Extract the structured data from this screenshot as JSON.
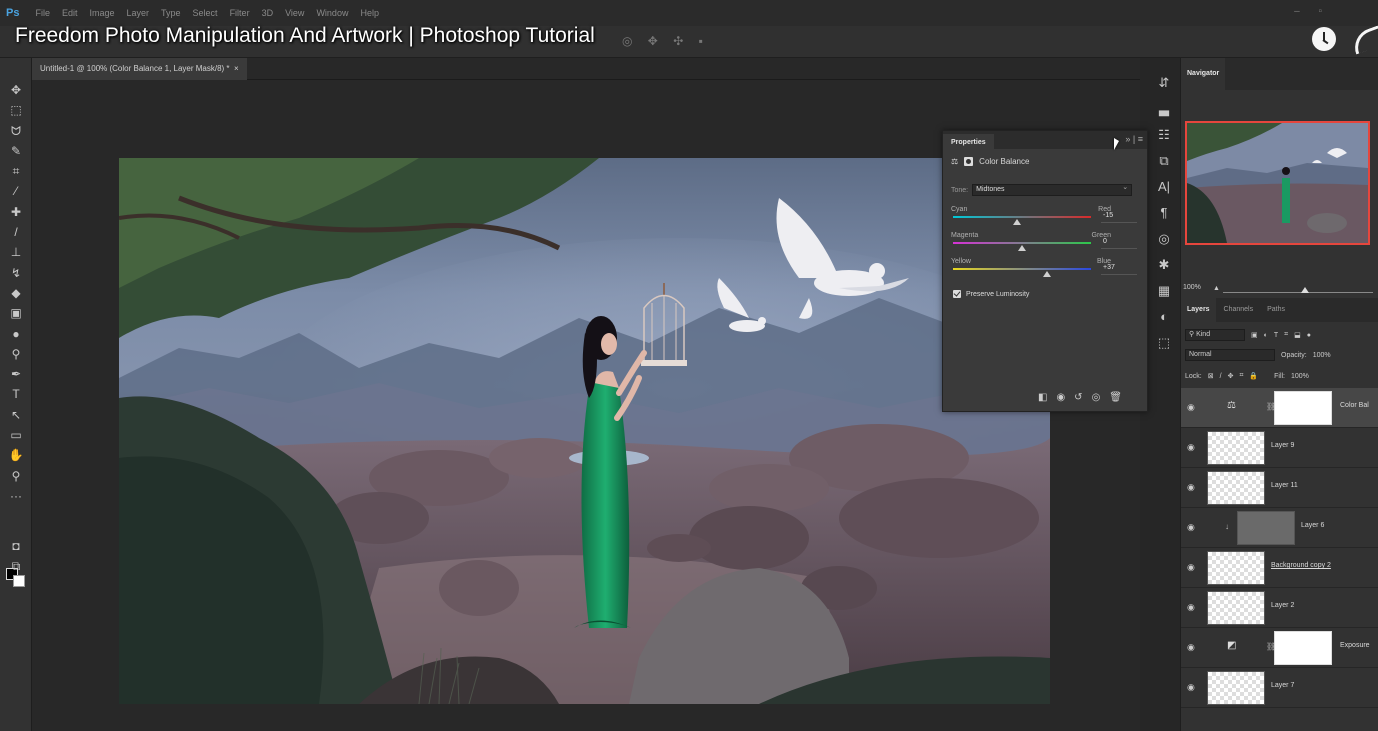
{
  "video_title": "Freedom Photo Manipulation And Artwork | Photoshop Tutorial",
  "app": {
    "logo": "Ps",
    "menu": [
      "File",
      "Edit",
      "Image",
      "Layer",
      "Type",
      "Select",
      "Filter",
      "3D",
      "View",
      "Window",
      "Help"
    ]
  },
  "document": {
    "tab_label": "Untitled-1 @ 100% (Color Balance 1, Layer Mask/8) *",
    "close_glyph": "×"
  },
  "properties": {
    "tab": "Properties",
    "collapse_glyph": "»",
    "menu_glyph": "≡",
    "adjustment_name": "Color Balance",
    "tone_label": "Tone:",
    "tone_value": "Midtones",
    "sliders": [
      {
        "left": "Cyan",
        "right": "Red",
        "value": "-15",
        "colors": [
          "#00c8d8",
          "#d82a2a"
        ],
        "position": 0.43
      },
      {
        "left": "Magenta",
        "right": "Green",
        "value": "0",
        "colors": [
          "#d632d6",
          "#2cc84a"
        ],
        "position": 0.5
      },
      {
        "left": "Yellow",
        "right": "Blue",
        "value": "+37",
        "colors": [
          "#e8d820",
          "#2a48e0"
        ],
        "position": 0.68
      }
    ],
    "preserve_luminosity": "Preserve Luminosity"
  },
  "navigator": {
    "tab": "Navigator",
    "zoom": "100%"
  },
  "layers_panel": {
    "tabs": [
      "Layers",
      "Channels",
      "Paths"
    ],
    "filter_kind": "Kind",
    "blend_mode": "Normal",
    "opacity_label": "Opacity:",
    "opacity_value": "100%",
    "lock_label": "Lock:",
    "fill_label": "Fill:",
    "fill_value": "100%",
    "layers": [
      {
        "name": "Color Bal",
        "type": "adjustment",
        "selected": true
      },
      {
        "name": "Layer 9",
        "type": "pixel"
      },
      {
        "name": "Layer 11",
        "type": "pixel"
      },
      {
        "name": "Layer 6",
        "type": "clipped"
      },
      {
        "name": "Background copy 2",
        "type": "pixel"
      },
      {
        "name": "Layer 2",
        "type": "pixel"
      },
      {
        "name": "Exposure",
        "type": "adjustment"
      },
      {
        "name": "Layer 7",
        "type": "pixel"
      }
    ]
  },
  "colors": {
    "selection_red": "#e6463d",
    "dress_green": "#1a9a62",
    "panel_bg": "#323232"
  }
}
